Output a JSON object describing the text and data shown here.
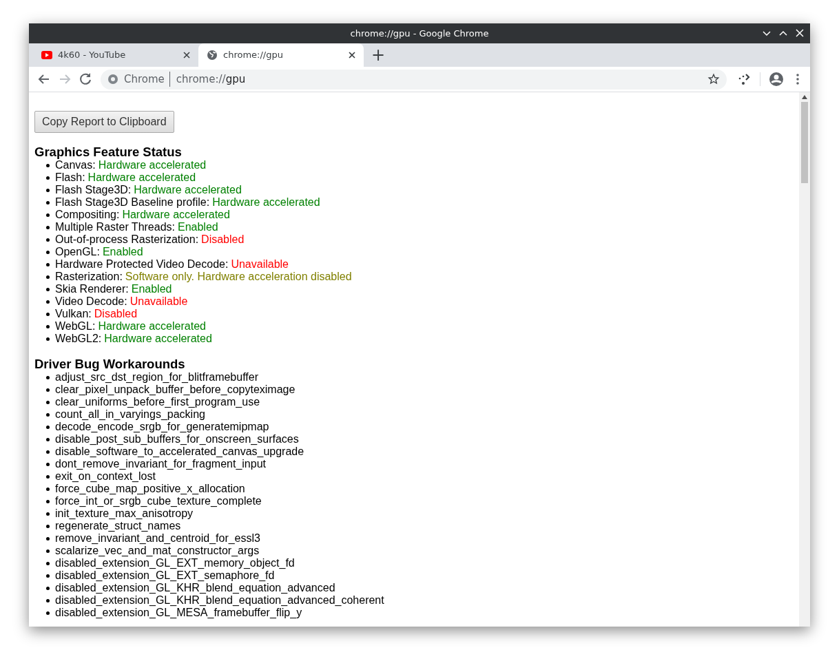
{
  "window": {
    "title": "chrome://gpu - Google Chrome"
  },
  "tabs": [
    {
      "title": "4k60 - YouTube",
      "selected": false,
      "kind": "video"
    },
    {
      "title": "chrome://gpu",
      "selected": true,
      "kind": "web"
    }
  ],
  "new_tab": "+",
  "address_bar": {
    "chip": "Chrome",
    "url_prefix": "chrome://",
    "url_host": "gpu"
  },
  "copy_button": "Copy Report to Clipboard",
  "feature_status": {
    "heading": "Graphics Feature Status",
    "items": [
      {
        "name": "Canvas:",
        "status": "Hardware accelerated",
        "kind": "ok"
      },
      {
        "name": "Flash:",
        "status": "Hardware accelerated",
        "kind": "ok"
      },
      {
        "name": "Flash Stage3D:",
        "status": "Hardware accelerated",
        "kind": "ok"
      },
      {
        "name": "Flash Stage3D Baseline profile:",
        "status": "Hardware accelerated",
        "kind": "ok"
      },
      {
        "name": "Compositing:",
        "status": "Hardware accelerated",
        "kind": "ok"
      },
      {
        "name": "Multiple Raster Threads:",
        "status": "Enabled",
        "kind": "ok"
      },
      {
        "name": "Out-of-process Rasterization:",
        "status": "Disabled",
        "kind": "bad"
      },
      {
        "name": "OpenGL:",
        "status": "Enabled",
        "kind": "ok"
      },
      {
        "name": "Hardware Protected Video Decode:",
        "status": "Unavailable",
        "kind": "bad"
      },
      {
        "name": "Rasterization:",
        "status": "Software only. Hardware acceleration disabled",
        "kind": "warn"
      },
      {
        "name": "Skia Renderer:",
        "status": "Enabled",
        "kind": "ok"
      },
      {
        "name": "Video Decode:",
        "status": "Unavailable",
        "kind": "bad"
      },
      {
        "name": "Vulkan:",
        "status": "Disabled",
        "kind": "bad"
      },
      {
        "name": "WebGL:",
        "status": "Hardware accelerated",
        "kind": "ok"
      },
      {
        "name": "WebGL2:",
        "status": "Hardware accelerated",
        "kind": "ok"
      }
    ]
  },
  "workarounds": {
    "heading": "Driver Bug Workarounds",
    "items": [
      "adjust_src_dst_region_for_blitframebuffer",
      "clear_pixel_unpack_buffer_before_copyteximage",
      "clear_uniforms_before_first_program_use",
      "count_all_in_varyings_packing",
      "decode_encode_srgb_for_generatemipmap",
      "disable_post_sub_buffers_for_onscreen_surfaces",
      "disable_software_to_accelerated_canvas_upgrade",
      "dont_remove_invariant_for_fragment_input",
      "exit_on_context_lost",
      "force_cube_map_positive_x_allocation",
      "force_int_or_srgb_cube_texture_complete",
      "init_texture_max_anisotropy",
      "regenerate_struct_names",
      "remove_invariant_and_centroid_for_essl3",
      "scalarize_vec_and_mat_constructor_args",
      "disabled_extension_GL_EXT_memory_object_fd",
      "disabled_extension_GL_EXT_semaphore_fd",
      "disabled_extension_GL_KHR_blend_equation_advanced",
      "disabled_extension_GL_KHR_blend_equation_advanced_coherent",
      "disabled_extension_GL_MESA_framebuffer_flip_y"
    ]
  }
}
